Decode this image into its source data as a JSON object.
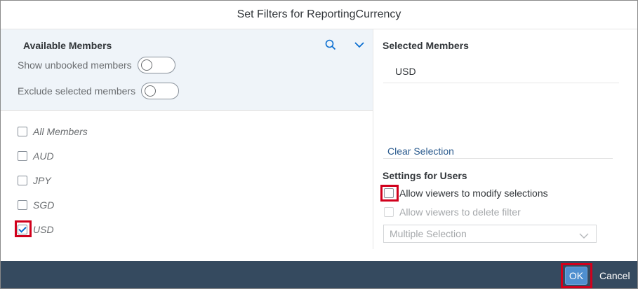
{
  "dialog": {
    "title": "Set Filters for ReportingCurrency"
  },
  "available": {
    "title": "Available Members",
    "search_icon": "search-icon",
    "expand_icon": "chevron-down-icon",
    "show_unbooked_label": "Show unbooked members",
    "show_unbooked_on": false,
    "exclude_selected_label": "Exclude selected members",
    "exclude_selected_on": false,
    "members": [
      {
        "label": "All Members",
        "checked": false
      },
      {
        "label": "AUD",
        "checked": false
      },
      {
        "label": "JPY",
        "checked": false
      },
      {
        "label": "SGD",
        "checked": false
      },
      {
        "label": "USD",
        "checked": true
      }
    ]
  },
  "selected": {
    "title": "Selected Members",
    "items": [
      "USD"
    ],
    "clear_label": "Clear Selection"
  },
  "settings": {
    "title": "Settings for Users",
    "allow_modify_label": "Allow viewers to modify selections",
    "allow_modify_checked": false,
    "allow_delete_label": "Allow viewers to delete filter",
    "allow_delete_checked": false,
    "allow_delete_disabled": true,
    "selection_mode_value": "Multiple Selection"
  },
  "footer": {
    "ok_label": "OK",
    "cancel_label": "Cancel"
  },
  "colors": {
    "accent": "#0a6ed1",
    "footer_bg": "#354a5f",
    "highlight": "#d1001c",
    "header_bg": "#eff4f9"
  }
}
